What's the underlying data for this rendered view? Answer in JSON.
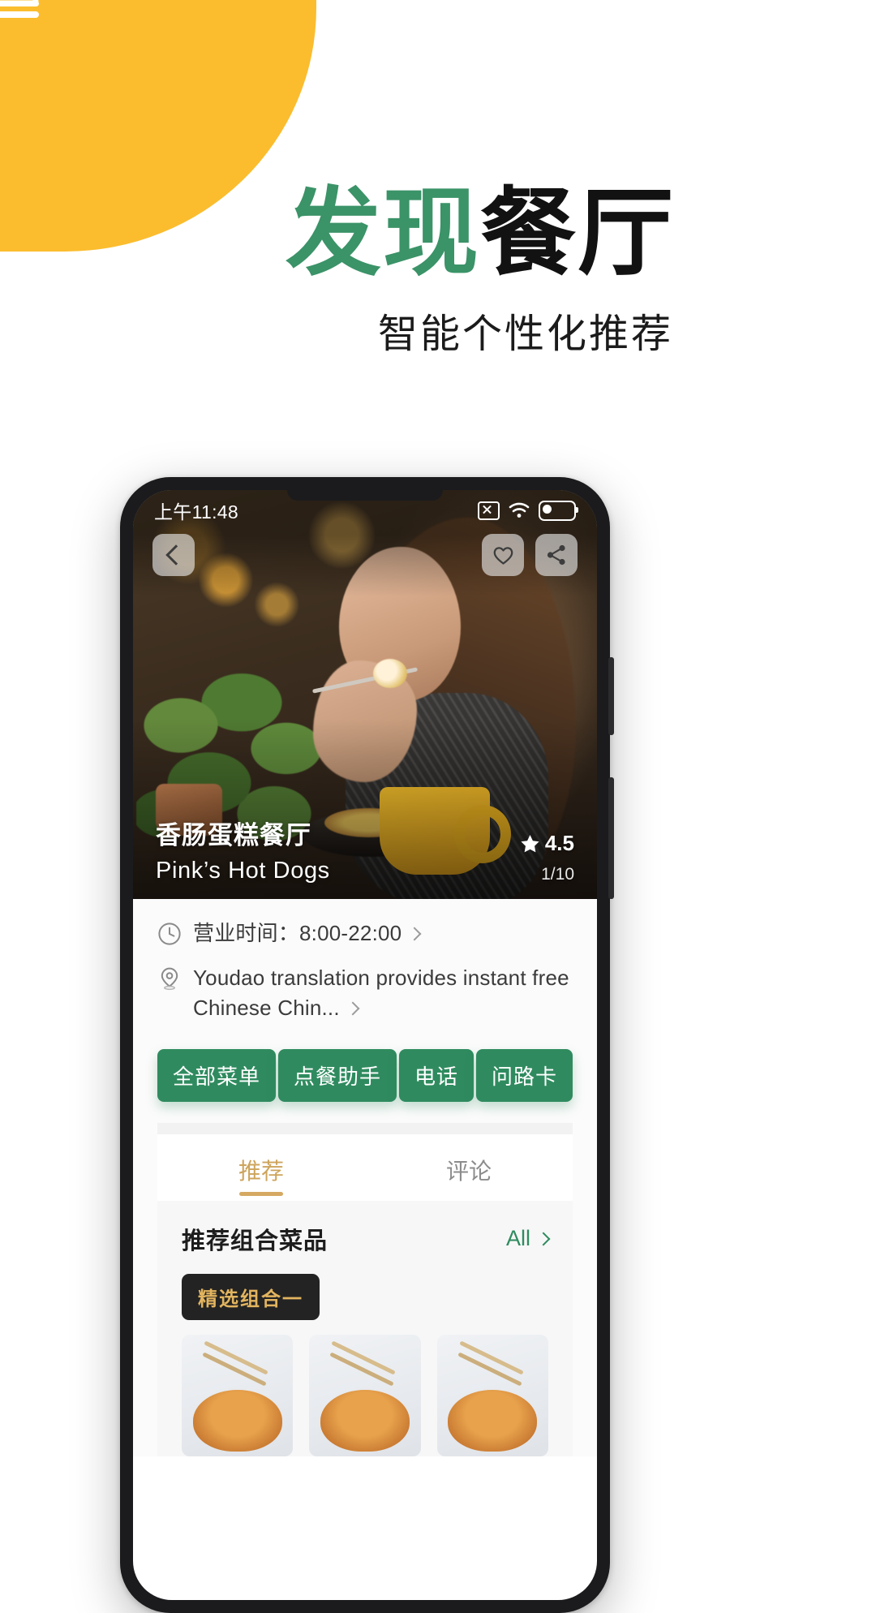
{
  "brand": {
    "icon": "service-bell-icon",
    "blob_color": "#fbbd2e"
  },
  "hero_copy": {
    "headline_green": "发现",
    "headline_black": "餐厅",
    "subhead": "智能个性化推荐",
    "green": "#3b9368"
  },
  "phone": {
    "status_bar": {
      "time": "上午11:48",
      "icons": [
        "close-box-icon",
        "wifi-icon",
        "battery-icon"
      ]
    },
    "hero": {
      "back_icon": "chevron-left-icon",
      "favorite_icon": "heart-icon",
      "share_icon": "share-icon",
      "restaurant_name_cn": "香肠蛋糕餐厅",
      "restaurant_name_en": "Pink’s Hot Dogs",
      "rating": "4.5",
      "star_icon": "star-icon",
      "photo_count": "1/10"
    },
    "info": {
      "hours_icon": "clock-icon",
      "hours_label": "营业时间：8:00-22:00",
      "address_icon": "location-pin-icon",
      "address_label": "Youdao translation provides instant free Chinese Chin...",
      "chevron_icon": "chevron-right-icon"
    },
    "actions": [
      {
        "label": "全部菜单"
      },
      {
        "label": "点餐助手"
      },
      {
        "label": "电话"
      },
      {
        "label": "问路卡"
      }
    ],
    "action_color": "#2f8b5f",
    "tabs": [
      {
        "label": "推荐",
        "active": true
      },
      {
        "label": "评论",
        "active": false
      }
    ],
    "tab_active_color": "#cda45c",
    "recommend": {
      "section_title": "推荐组合菜品",
      "all_label": "All",
      "combo_badge": "精选组合一",
      "thumbs": [
        {
          "name": "dish-thumb-1"
        },
        {
          "name": "dish-thumb-2"
        },
        {
          "name": "dish-thumb-3"
        }
      ]
    }
  }
}
